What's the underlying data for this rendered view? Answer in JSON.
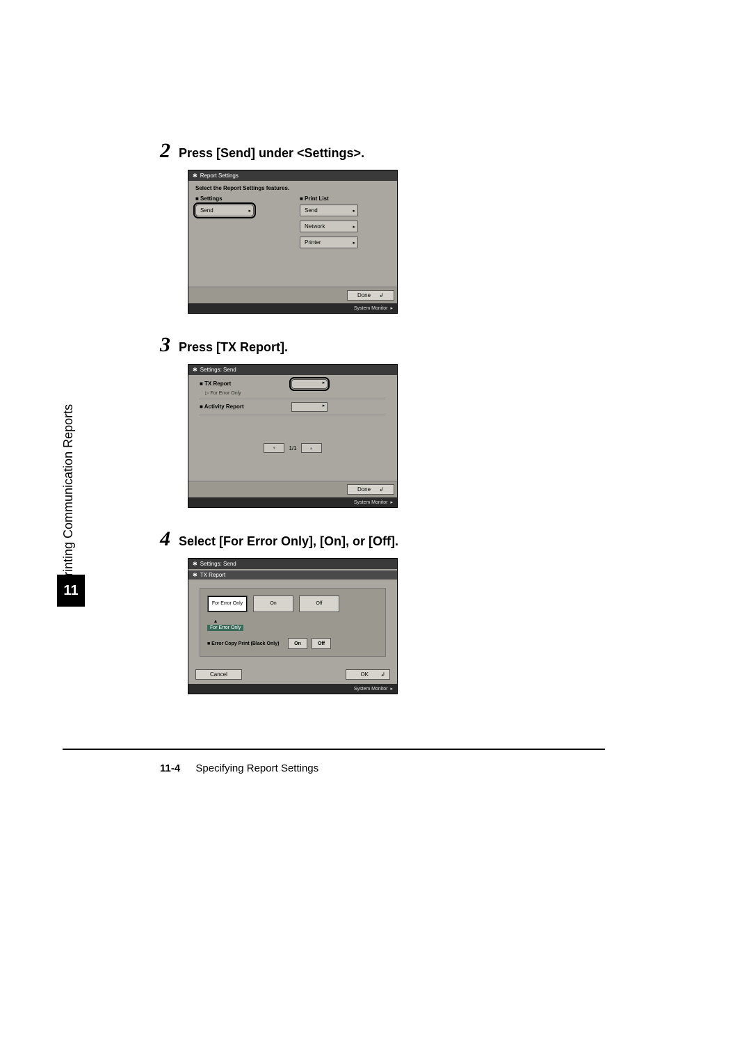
{
  "sidebar": {
    "section_title": "Printing Communication Reports",
    "chapter_number": "11"
  },
  "steps": [
    {
      "num": "2",
      "title": "Press [Send] under <Settings>.",
      "screenshot": {
        "header": "Report Settings",
        "instruction": "Select the Report Settings features.",
        "col_settings_label": "■ Settings",
        "col_printlist_label": "■ Print List",
        "settings_buttons": [
          "Send"
        ],
        "printlist_buttons": [
          "Send",
          "Network",
          "Printer"
        ],
        "done_label": "Done",
        "sysmon_label": "System Monitor"
      }
    },
    {
      "num": "3",
      "title": "Press [TX Report].",
      "screenshot": {
        "header": "Settings: Send",
        "rows": [
          {
            "label": "■ TX Report",
            "sub": "▷ For Error Only",
            "highlight": true
          },
          {
            "label": "■ Activity Report",
            "sub": "",
            "highlight": false
          }
        ],
        "pager": "1/1",
        "done_label": "Done",
        "sysmon_label": "System Monitor"
      }
    },
    {
      "num": "4",
      "title": "Select [For Error Only], [On], or [Off].",
      "screenshot": {
        "header": "Settings: Send",
        "subheader": "TX Report",
        "options": [
          "For Error\nOnly",
          "On",
          "Off"
        ],
        "marker": "For Error Only",
        "subrow_label": "■ Error Copy Print (Black Only)",
        "subrow_buttons": [
          "On",
          "Off"
        ],
        "cancel_label": "Cancel",
        "ok_label": "OK",
        "sysmon_label": "System Monitor"
      }
    }
  ],
  "footer": {
    "page_number": "11-4",
    "title": "Specifying Report Settings"
  }
}
